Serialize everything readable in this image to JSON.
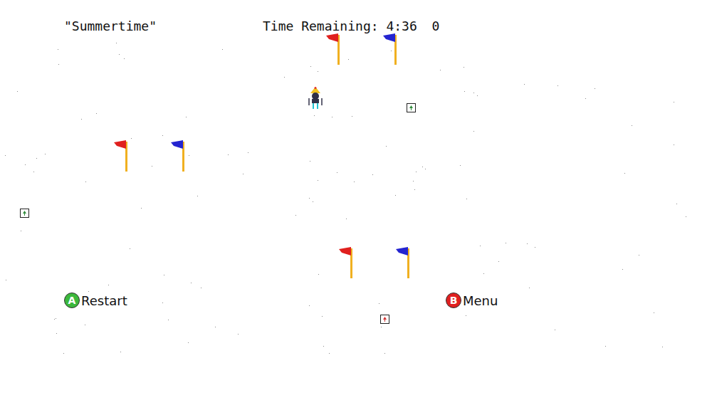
{
  "game": {
    "title": "\"Summertime\"",
    "timer_label": "Time Remaining:",
    "time": "4:36",
    "score": "0"
  },
  "gates": [
    {
      "flags": [
        {
          "color": "#e0201e"
        },
        {
          "color": "#2424d0"
        }
      ]
    },
    {
      "flags": [
        {
          "color": "#e0201e"
        },
        {
          "color": "#2424d0"
        }
      ]
    },
    {
      "flags": [
        {
          "color": "#e0201e"
        },
        {
          "color": "#2424d0"
        }
      ]
    }
  ],
  "pickups": [
    {
      "color": "#2e8b3a"
    },
    {
      "color": "#2e8b3a"
    },
    {
      "color": "#d03030"
    }
  ],
  "buttons": [
    {
      "key": "A",
      "label": "Restart",
      "color": "#3cb83c"
    },
    {
      "key": "B",
      "label": "Menu",
      "color": "#e02020"
    }
  ]
}
